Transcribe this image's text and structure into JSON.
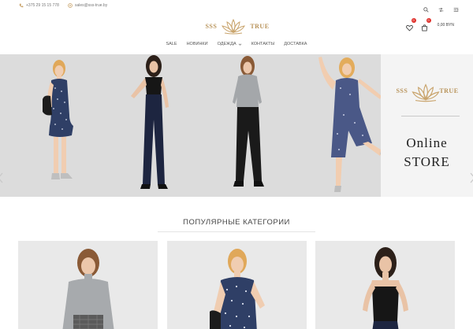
{
  "topbar": {
    "phone": "+375 29 15 15 778",
    "email": "sales@sss-true.by",
    "icons": [
      "search-icon",
      "shuffle-icon",
      "compare-icon"
    ]
  },
  "header": {
    "logo_left": "SSS",
    "logo_right": "TRUE",
    "wishlist_count": "0",
    "cart_count": "0",
    "cart_total": "0,00 BYN"
  },
  "nav": {
    "items": [
      {
        "label": "SALE"
      },
      {
        "label": "НОВИНКИ"
      },
      {
        "label": "ОДЕЖДА"
      },
      {
        "label": "КОНТАКТЫ"
      },
      {
        "label": "ДОСТАВКА"
      }
    ]
  },
  "hero": {
    "side_logo_left": "SSS",
    "side_logo_right": "TRUE",
    "line1": "Online",
    "line2": "STORE"
  },
  "section": {
    "title": "ПОПУЛЯРНЫЕ КАТЕГОРИИ"
  },
  "colors": {
    "brand_gold": "#b8935a",
    "badge_red": "#e0302b",
    "hero_bg": "#dcdcdc"
  }
}
